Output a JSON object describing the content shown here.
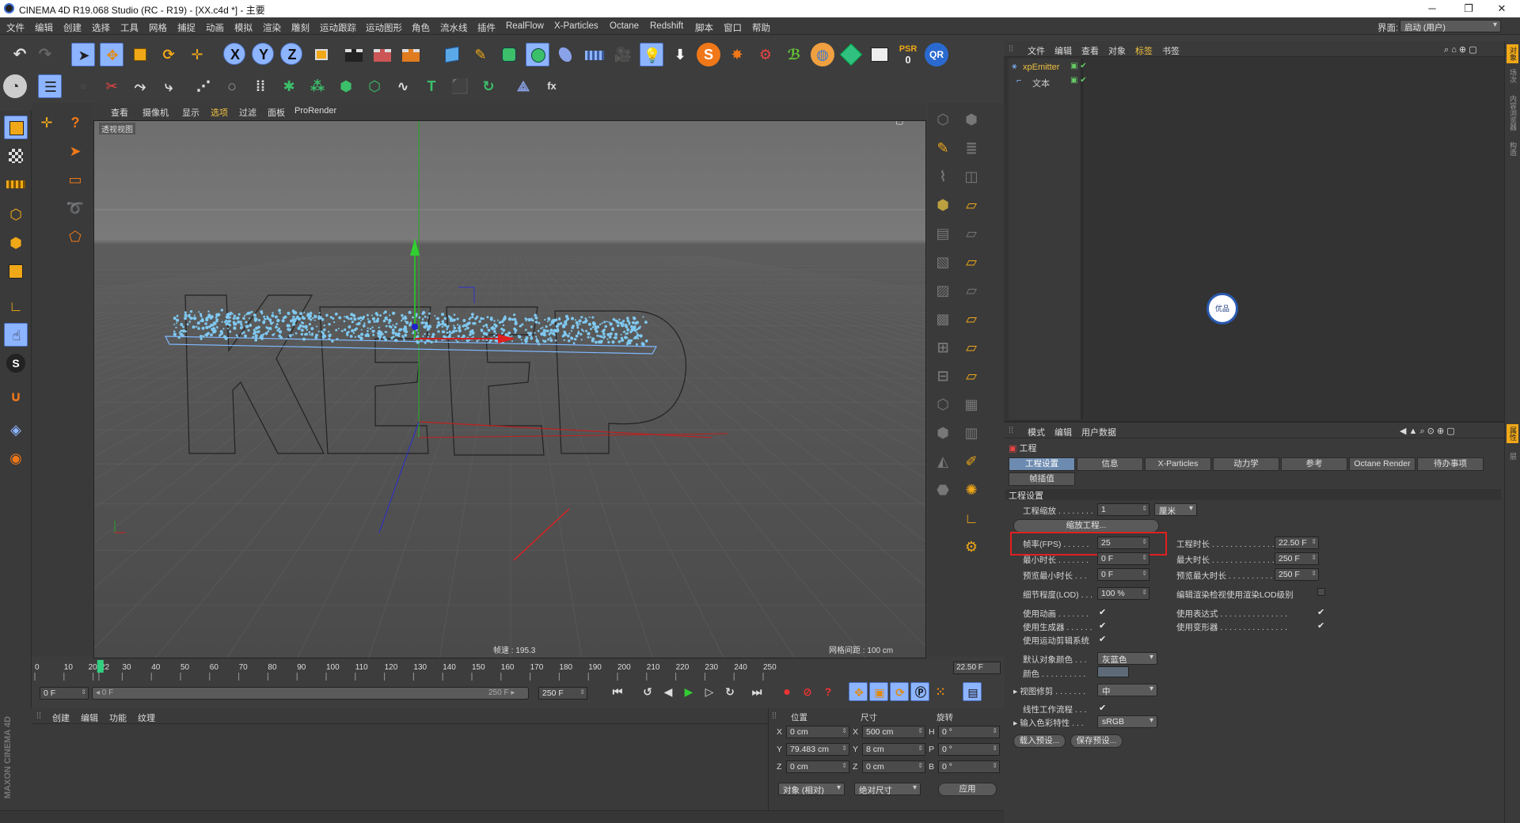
{
  "window": {
    "title": "CINEMA 4D R19.068 Studio (RC - R19) - [XX.c4d *] - 主要",
    "minimize": "─",
    "maximize": "❐",
    "close": "✕"
  },
  "menubar": {
    "items": [
      "文件",
      "编辑",
      "创建",
      "选择",
      "工具",
      "网格",
      "捕捉",
      "动画",
      "模拟",
      "渲染",
      "雕刻",
      "运动跟踪",
      "运动图形",
      "角色",
      "流水线",
      "插件",
      "RealFlow",
      "X-Particles",
      "Octane",
      "Redshift",
      "脚本",
      "窗口",
      "帮助"
    ],
    "layout_label": "界面:",
    "layout_value": "启动 (用户)"
  },
  "toolbar": {
    "axis_x": "X",
    "axis_y": "Y",
    "axis_z": "Z",
    "psr_label": "PSR",
    "psr_value": "0",
    "qr": "QR",
    "text_tool": "T",
    "fx": "fx"
  },
  "viewport": {
    "menu": [
      "查看",
      "摄像机",
      "显示",
      "选项",
      "过滤",
      "面板",
      "ProRender"
    ],
    "view_label": "透视视图",
    "speed_label": "帧速 : 195.3",
    "grid_label": "网格间距 : 100 cm",
    "scene_text": "KEEP"
  },
  "object_manager": {
    "menu": [
      "文件",
      "编辑",
      "查看",
      "对象",
      "标签",
      "书签"
    ],
    "objects": [
      {
        "name": "xpEmitter"
      },
      {
        "name": "文本"
      }
    ]
  },
  "attribute_manager": {
    "menu": [
      "模式",
      "编辑",
      "用户数据"
    ],
    "object_title": "工程",
    "tabs": [
      "工程设置",
      "信息",
      "X-Particles",
      "动力学",
      "参考",
      "Octane Render",
      "待办事项"
    ],
    "tab2": "帧插值",
    "section": "工程设置",
    "scale_label": "工程缩放 . . . . . . . .",
    "scale_value": "1",
    "scale_unit": "厘米",
    "scale_button": "缩放工程...",
    "fps_label": "帧率(FPS) . . . . . .",
    "fps_value": "25",
    "project_time_label": "工程时长 . . . . . . . . . . . . . . . .",
    "project_time_value": "22.50 F",
    "min_time_label": "最小时长 . . . . . . .",
    "min_time_value": "0 F",
    "max_time_label": "最大时长 . . . . . . . . . . . . . . . .",
    "max_time_value": "250 F",
    "preview_min_label": "预览最小时长 . . .",
    "preview_min_value": "0 F",
    "preview_max_label": "预览最大时长 . . . . . . . . . . . . .",
    "preview_max_value": "250 F",
    "lod_label": "细节程度(LOD) . . .",
    "lod_value": "100 %",
    "lod_render_label": "编辑渲染检视使用渲染LOD级别",
    "use_anim_label": "使用动画 . . . . . . .",
    "use_expr_label": "使用表达式 . . . . . . . . . . . . . . .",
    "use_gen_label": "使用生成器 . . . . . .",
    "use_deform_label": "使用变形器 . . . . . . . . . . . . . . .",
    "use_motion_label": "使用运动剪辑系统",
    "default_color_label": "默认对象颜色 . . .",
    "default_color_value": "灰蓝色",
    "color_label": "颜色 . . . . . . . . . .",
    "view_clip_label": "视图修剪 . . . . . . .",
    "view_clip_value": "中",
    "linear_label": "线性工作流程 . . .",
    "color_profile_label": "输入色彩特性 . . .",
    "color_profile_value": "sRGB",
    "load_preset": "载入预设...",
    "save_preset": "保存预设...",
    "check": "✔"
  },
  "timeline": {
    "ticks": [
      "0",
      "10",
      "20",
      "22",
      "30",
      "40",
      "50",
      "60",
      "70",
      "80",
      "90",
      "100",
      "110",
      "120",
      "130",
      "140",
      "150",
      "160",
      "170",
      "180",
      "190",
      "200",
      "210",
      "220",
      "230",
      "240",
      "250"
    ],
    "current_frame_readout": "22.50 F",
    "start_field": "0 F",
    "range_start": "◂ 0 F",
    "range_end": "250 F ▸",
    "end_field": "250 F"
  },
  "material_manager": {
    "menu": [
      "创建",
      "编辑",
      "功能",
      "纹理"
    ]
  },
  "coords": {
    "headers": [
      "位置",
      "尺寸",
      "旋转"
    ],
    "rows": [
      {
        "axis": "X",
        "pos": "0 cm",
        "size_axis": "X",
        "size": "500 cm",
        "rot_axis": "H",
        "rot": "0 °"
      },
      {
        "axis": "Y",
        "pos": "79.483 cm",
        "size_axis": "Y",
        "size": "8 cm",
        "rot_axis": "P",
        "rot": "0 °"
      },
      {
        "axis": "Z",
        "pos": "0 cm",
        "size_axis": "Z",
        "size": "0 cm",
        "rot_axis": "B",
        "rot": "0 °"
      }
    ],
    "mode": "对象 (相对)",
    "size_mode": "绝对尺寸",
    "apply": "应用"
  },
  "side_tabs": [
    "对象",
    "场次",
    "内容浏览器",
    "构造",
    "属性",
    "层"
  ],
  "maxon_brand": "MAXON CINEMA 4D",
  "watermark": "优品",
  "colors": {
    "accent": "#8db4ff",
    "highlight": "#e02020",
    "particles": "#7fc8f0"
  }
}
